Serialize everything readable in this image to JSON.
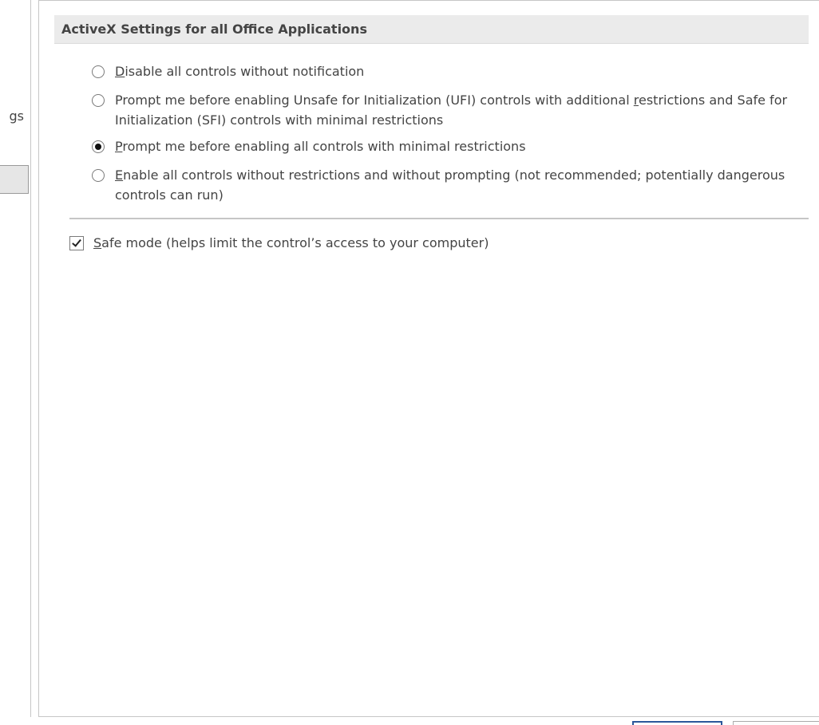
{
  "left_nav": {
    "partial_item_text": "gs"
  },
  "section": {
    "title": "ActiveX Settings for all Office Applications"
  },
  "activex_options": [
    {
      "accel": "D",
      "text_before": "",
      "text_after": "isable all controls without notification",
      "checked": false
    },
    {
      "accel": "r",
      "text_before": "Prompt me before enabling Unsafe for Initialization (UFI) controls with additional ",
      "text_after": "estrictions and Safe for Initialization (SFI) controls with minimal restrictions",
      "checked": false
    },
    {
      "accel": "P",
      "text_before": "",
      "text_after": "rompt me before enabling all controls with minimal restrictions",
      "checked": true
    },
    {
      "accel": "E",
      "text_before": "",
      "text_after": "nable all controls without restrictions and without prompting (not recommended; potentially dangerous controls can run)",
      "checked": false
    }
  ],
  "safe_mode": {
    "accel": "S",
    "text_after": "afe mode (helps limit the control’s access to your computer)",
    "checked": true
  },
  "colors": {
    "header_bg": "#ebebeb",
    "border": "#c6c6c6",
    "text": "#444444",
    "accent": "#2b579a"
  }
}
